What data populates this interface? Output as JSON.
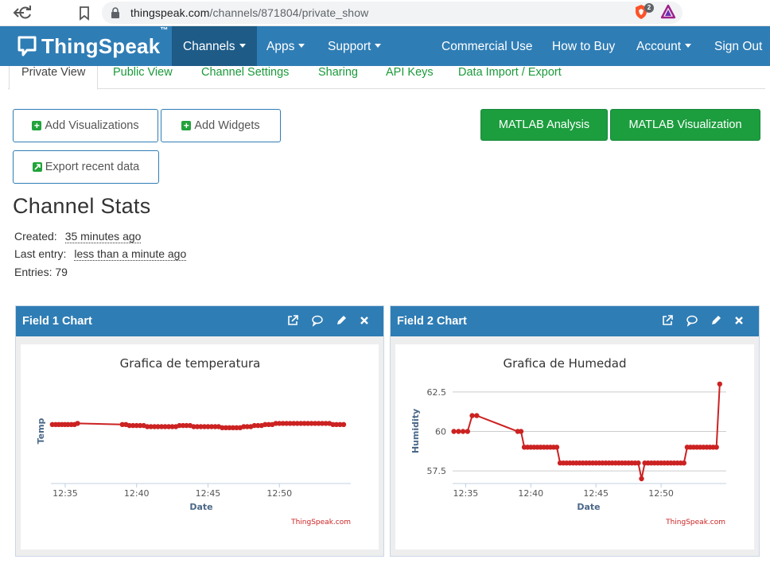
{
  "browser": {
    "url_host": "thingspeak.com",
    "url_path": "/channels/871804/private_show",
    "badge_count": "2"
  },
  "navbar": {
    "logo": "ThingSpeak",
    "logo_tm": "™",
    "items": [
      "Channels",
      "Apps",
      "Support",
      "Commercial Use",
      "How to Buy",
      "Account",
      "Sign Out"
    ]
  },
  "tabs": [
    "Private View",
    "Public View",
    "Channel Settings",
    "Sharing",
    "API Keys",
    "Data Import / Export"
  ],
  "buttons": {
    "add_visualizations": "Add Visualizations",
    "add_widgets": "Add Widgets",
    "export_recent": "Export recent data",
    "matlab_analysis": "MATLAB Analysis",
    "matlab_visualization": "MATLAB Visualization"
  },
  "stats": {
    "title": "Channel Stats",
    "created_label": "Created:",
    "created_value": "35 minutes ago",
    "last_entry_label": "Last entry:",
    "last_entry_value": "less than a minute ago",
    "entries_label": "Entries:",
    "entries_value": "79"
  },
  "panels": [
    {
      "title": "Field 1 Chart"
    },
    {
      "title": "Field 2 Chart"
    }
  ],
  "colors": {
    "primary": "#2f7db5",
    "green": "#1c9d3e",
    "series": "#cc2222"
  },
  "icons": [
    "external-link-icon",
    "comment-icon",
    "pencil-icon",
    "close-icon"
  ],
  "chart_data": [
    {
      "type": "line",
      "title": "Grafica de temperatura",
      "xlabel": "Date",
      "ylabel": "Temp",
      "xticks": [
        "12:35",
        "12:40",
        "12:45",
        "12:50"
      ],
      "yticks": [],
      "credit": "ThingSpeak.com",
      "xlim": [
        "12:34",
        "12:55"
      ],
      "ylim": [
        0,
        1
      ],
      "series": [
        {
          "x": [
            "12:34:06",
            "12:34:20",
            "12:34:33",
            "12:34:46",
            "12:34:59",
            "12:35:12",
            "12:35:26",
            "12:35:39",
            "12:35:52",
            "12:39:00",
            "12:39:15",
            "12:39:30",
            "12:39:45",
            "12:40:00",
            "12:40:15",
            "12:40:30",
            "12:40:45",
            "12:41:00",
            "12:41:15",
            "12:41:30",
            "12:41:45",
            "12:42:00",
            "12:42:15",
            "12:42:30",
            "12:42:45",
            "12:43:00",
            "12:43:15",
            "12:43:30",
            "12:43:45",
            "12:44:00",
            "12:44:15",
            "12:44:30",
            "12:44:45",
            "12:45:00",
            "12:45:15",
            "12:45:30",
            "12:45:45",
            "12:46:00",
            "12:46:15",
            "12:46:30",
            "12:46:45",
            "12:47:00",
            "12:47:15",
            "12:47:30",
            "12:47:45",
            "12:48:00",
            "12:48:15",
            "12:48:30",
            "12:48:45",
            "12:49:00",
            "12:49:15",
            "12:49:30",
            "12:49:45",
            "12:50:00",
            "12:50:15",
            "12:50:30",
            "12:50:45",
            "12:51:00",
            "12:51:15",
            "12:51:30",
            "12:51:45",
            "12:52:00",
            "12:52:15",
            "12:52:30",
            "12:52:45",
            "12:53:00",
            "12:53:15",
            "12:53:30",
            "12:53:45",
            "12:54:00",
            "12:54:15",
            "12:54:30"
          ],
          "y": [
            0.55,
            0.55,
            0.55,
            0.55,
            0.55,
            0.55,
            0.55,
            0.55,
            0.56,
            0.55,
            0.55,
            0.54,
            0.54,
            0.54,
            0.54,
            0.54,
            0.53,
            0.53,
            0.53,
            0.53,
            0.53,
            0.53,
            0.53,
            0.53,
            0.53,
            0.54,
            0.54,
            0.54,
            0.54,
            0.53,
            0.53,
            0.53,
            0.53,
            0.53,
            0.53,
            0.53,
            0.53,
            0.52,
            0.52,
            0.52,
            0.52,
            0.52,
            0.52,
            0.53,
            0.53,
            0.53,
            0.54,
            0.54,
            0.54,
            0.55,
            0.55,
            0.55,
            0.56,
            0.56,
            0.56,
            0.56,
            0.56,
            0.56,
            0.56,
            0.56,
            0.56,
            0.56,
            0.56,
            0.56,
            0.56,
            0.56,
            0.56,
            0.56,
            0.55,
            0.55,
            0.55,
            0.55
          ]
        }
      ]
    },
    {
      "type": "line",
      "title": "Grafica de Humedad",
      "xlabel": "Date",
      "ylabel": "Humidity",
      "xticks": [
        "12:35",
        "12:40",
        "12:45",
        "12:50"
      ],
      "yticks": [
        "62.5",
        "60",
        "57.5"
      ],
      "credit": "ThingSpeak.com",
      "xlim": [
        "12:34",
        "12:55"
      ],
      "ylim": [
        56.7,
        63.5
      ],
      "series": [
        {
          "x": [
            "12:34:06",
            "12:34:27",
            "12:34:48",
            "12:35:09",
            "12:35:30",
            "12:35:51",
            "12:39:00",
            "12:39:15",
            "12:39:30",
            "12:39:45",
            "12:40:00",
            "12:40:15",
            "12:40:30",
            "12:40:45",
            "12:41:00",
            "12:41:15",
            "12:41:30",
            "12:41:45",
            "12:42:00",
            "12:42:15",
            "12:42:30",
            "12:42:45",
            "12:43:00",
            "12:43:15",
            "12:43:30",
            "12:43:45",
            "12:44:00",
            "12:44:15",
            "12:44:30",
            "12:44:45",
            "12:45:00",
            "12:45:15",
            "12:45:30",
            "12:45:45",
            "12:46:00",
            "12:46:15",
            "12:46:30",
            "12:46:45",
            "12:47:00",
            "12:47:15",
            "12:47:30",
            "12:47:45",
            "12:48:00",
            "12:48:15",
            "12:48:30",
            "12:48:45",
            "12:49:00",
            "12:49:15",
            "12:49:30",
            "12:49:45",
            "12:50:00",
            "12:50:15",
            "12:50:30",
            "12:50:45",
            "12:51:00",
            "12:51:15",
            "12:51:30",
            "12:51:45",
            "12:52:00",
            "12:52:15",
            "12:52:30",
            "12:52:45",
            "12:53:00",
            "12:53:15",
            "12:53:30",
            "12:53:45",
            "12:54:00",
            "12:54:15",
            "12:54:30"
          ],
          "y": [
            60,
            60,
            60,
            60,
            61,
            61,
            60,
            60,
            59,
            59,
            59,
            59,
            59,
            59,
            59,
            59,
            59,
            59,
            59,
            58,
            58,
            58,
            58,
            58,
            58,
            58,
            58,
            58,
            58,
            58,
            58,
            58,
            58,
            58,
            58,
            58,
            58,
            58,
            58,
            58,
            58,
            58,
            58,
            58,
            57,
            58,
            58,
            58,
            58,
            58,
            58,
            58,
            58,
            58,
            58,
            58,
            58,
            58,
            59,
            59,
            59,
            59,
            59,
            59,
            59,
            59,
            59,
            59,
            63
          ]
        }
      ]
    }
  ]
}
